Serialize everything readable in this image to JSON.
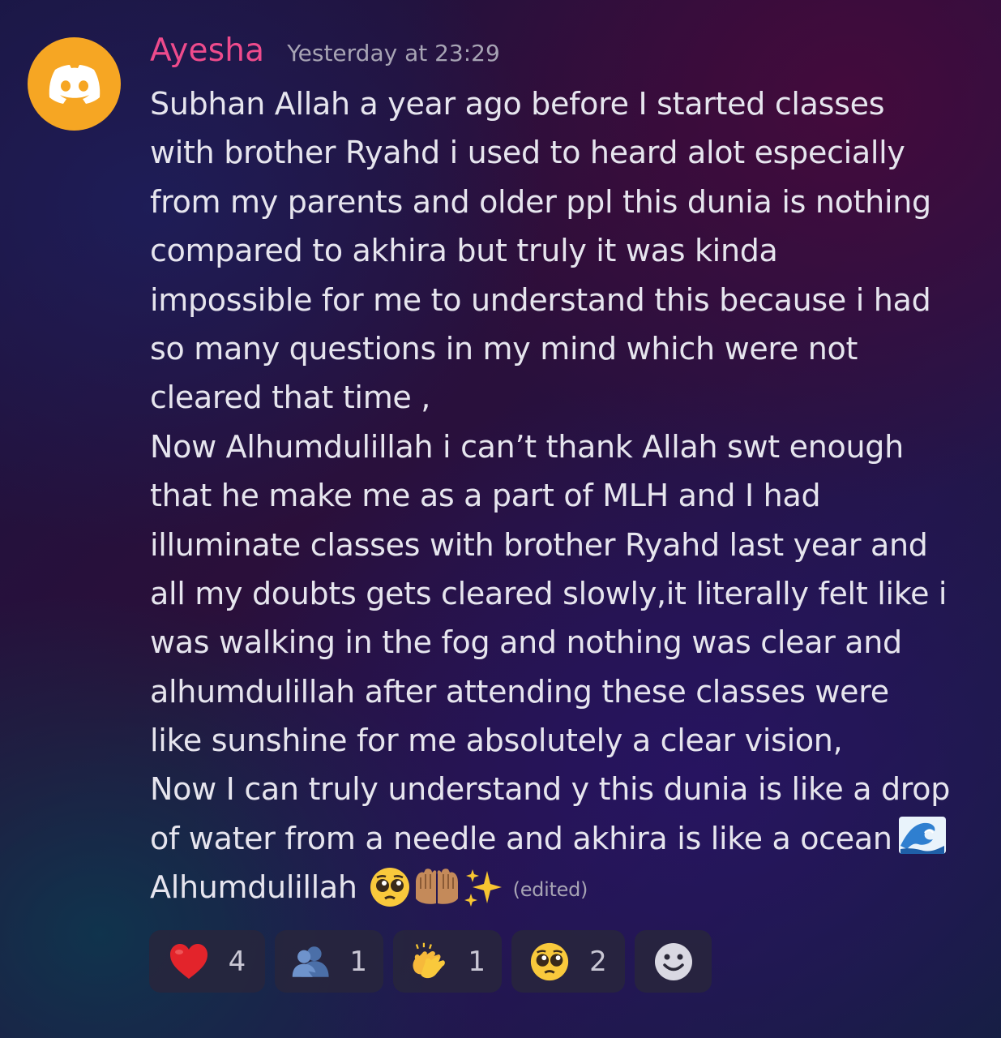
{
  "message": {
    "username": "Ayesha",
    "timestamp": "Yesterday at 23:29",
    "lines": [
      "Subhan Allah a year ago before I started classes",
      "with brother Ryahd  i used to heard alot especially",
      "from my parents and older ppl this dunia is nothing",
      "compared to akhira but truly it was kinda",
      "impossible for me to understand this because i had",
      "so many questions in my mind which were not",
      "cleared that time ,",
      "Now Alhumdulillah i can’t thank Allah swt enough",
      "that he make me as a part of MLH and I had",
      "illuminate classes with brother Ryahd last year and",
      "all my doubts gets cleared slowly,it literally felt like i",
      "was walking in the fog and nothing was clear and",
      "alhumdulillah after attending these classes were",
      "like sunshine for me absolutely a clear vision,",
      "Now I can truly understand y this dunia is like a drop",
      "of water from a needle and akhira is like a ocean"
    ],
    "last_line": "Alhumdulillah",
    "edited": "(edited)",
    "inline_emojis": [
      "pleading-face",
      "palms-up-together",
      "sparkles"
    ],
    "trailing_emoji": "water-wave"
  },
  "avatar": {
    "icon": "discord-logo-icon",
    "color": "#f6a623"
  },
  "reactions": [
    {
      "emoji": "red-heart",
      "count": "4"
    },
    {
      "emoji": "people-hugging",
      "count": "1"
    },
    {
      "emoji": "clapping-hands",
      "count": "1"
    },
    {
      "emoji": "pleading-face",
      "count": "2"
    }
  ],
  "add_reaction_icon": "add-reaction-smiley-icon",
  "colors": {
    "username": "#ee4b8c",
    "timestamp": "#a7a4b4",
    "text": "#e6e5ee"
  }
}
